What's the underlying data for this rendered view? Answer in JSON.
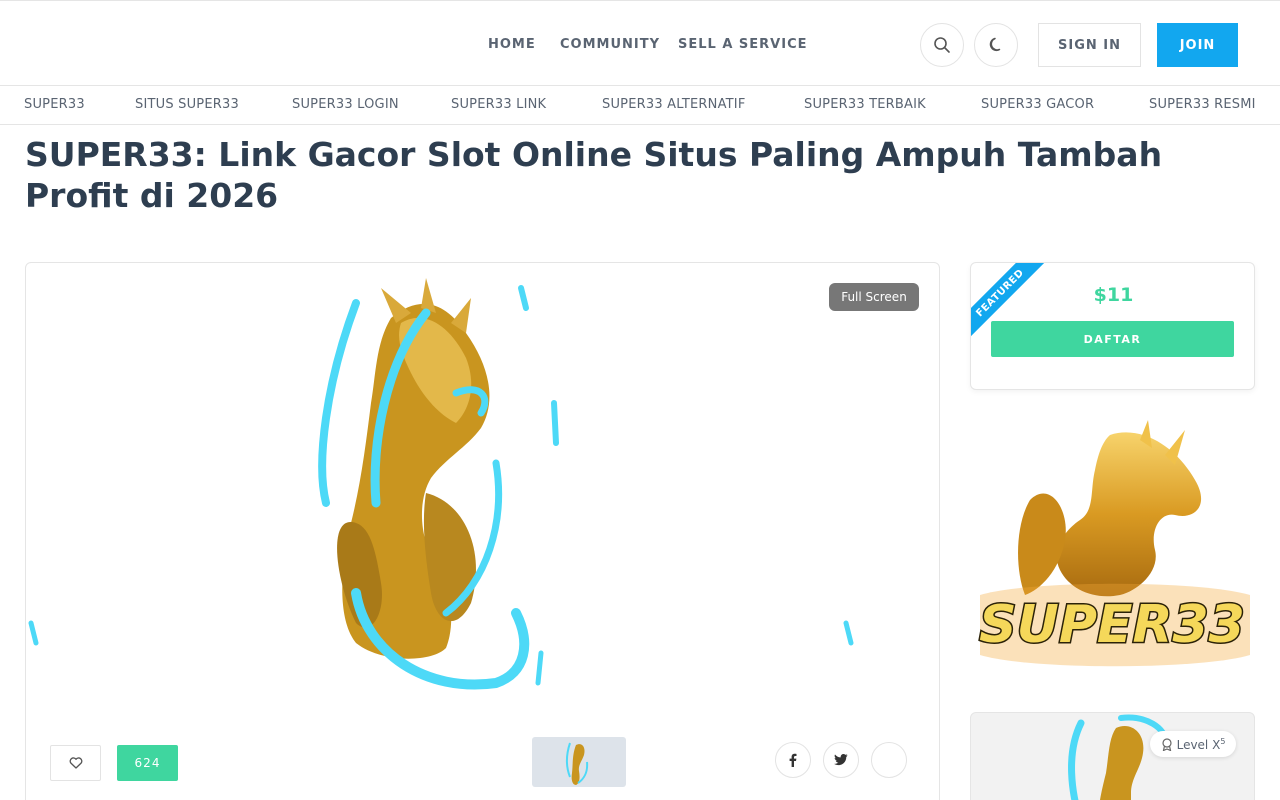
{
  "nav": {
    "home": "HOME",
    "community": "COMMUNITY",
    "sell": "SELL A SERVICE",
    "signin": "SIGN IN",
    "join": "JOIN"
  },
  "categories": [
    "SUPER33",
    "SITUS SUPER33",
    "SUPER33 LOGIN",
    "SUPER33 LINK",
    "SUPER33 ALTERNATIF",
    "SUPER33 TERBAIK",
    "SUPER33 GACOR",
    "SUPER33 RESMI"
  ],
  "page": {
    "title": "SUPER33: Link Gacor Slot Online Situs Paling Ampuh Tambah Profit di 2026"
  },
  "media": {
    "fullscreen_label": "Full Screen",
    "like_count": "624"
  },
  "pricing": {
    "ribbon": "FEATURED",
    "price": "$11",
    "cta": "DAFTAR"
  },
  "logo": {
    "text": "SUPER33"
  },
  "badge": {
    "level_label": "Level X",
    "level_sup": "5"
  },
  "colors": {
    "accent_blue": "#12a7ef",
    "accent_green": "#3fd69f",
    "gold": "#c9951f",
    "swirl": "#4dd9f7"
  }
}
